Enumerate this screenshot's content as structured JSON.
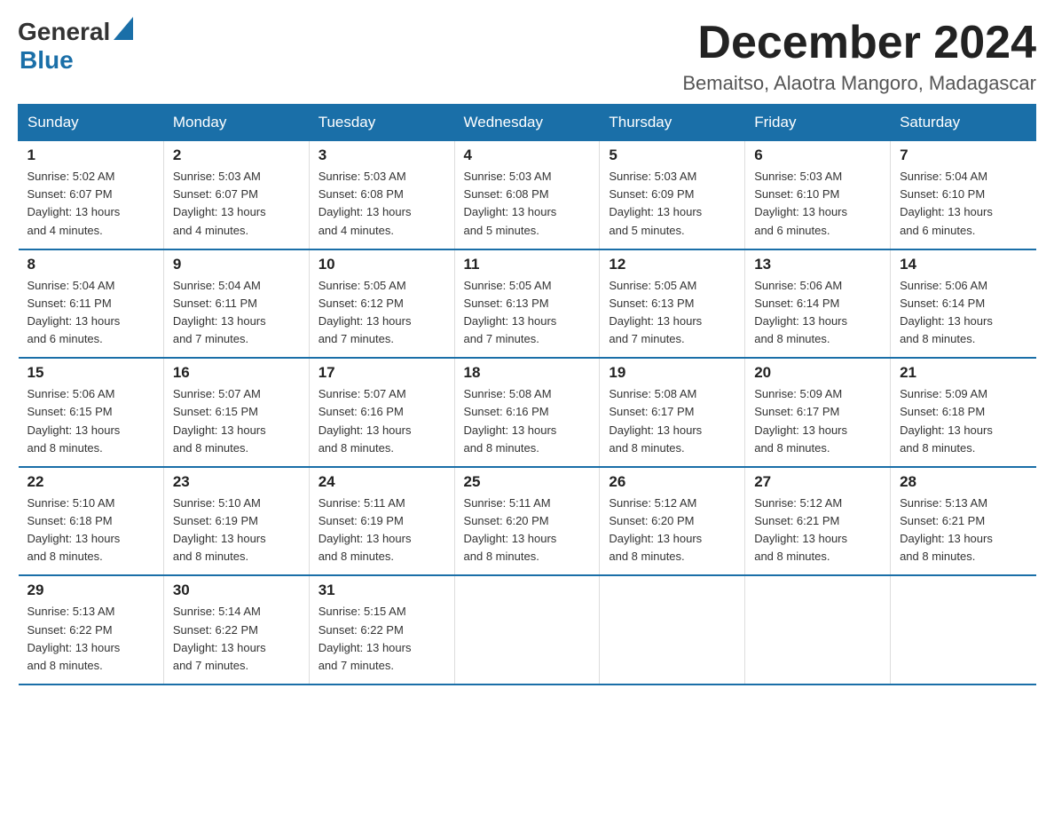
{
  "header": {
    "logo_general": "General",
    "logo_blue": "Blue",
    "title": "December 2024",
    "subtitle": "Bemaitso, Alaotra Mangoro, Madagascar"
  },
  "days_of_week": [
    "Sunday",
    "Monday",
    "Tuesday",
    "Wednesday",
    "Thursday",
    "Friday",
    "Saturday"
  ],
  "weeks": [
    [
      {
        "day": "1",
        "sunrise": "5:02 AM",
        "sunset": "6:07 PM",
        "daylight": "13 hours and 4 minutes."
      },
      {
        "day": "2",
        "sunrise": "5:03 AM",
        "sunset": "6:07 PM",
        "daylight": "13 hours and 4 minutes."
      },
      {
        "day": "3",
        "sunrise": "5:03 AM",
        "sunset": "6:08 PM",
        "daylight": "13 hours and 4 minutes."
      },
      {
        "day": "4",
        "sunrise": "5:03 AM",
        "sunset": "6:08 PM",
        "daylight": "13 hours and 5 minutes."
      },
      {
        "day": "5",
        "sunrise": "5:03 AM",
        "sunset": "6:09 PM",
        "daylight": "13 hours and 5 minutes."
      },
      {
        "day": "6",
        "sunrise": "5:03 AM",
        "sunset": "6:10 PM",
        "daylight": "13 hours and 6 minutes."
      },
      {
        "day": "7",
        "sunrise": "5:04 AM",
        "sunset": "6:10 PM",
        "daylight": "13 hours and 6 minutes."
      }
    ],
    [
      {
        "day": "8",
        "sunrise": "5:04 AM",
        "sunset": "6:11 PM",
        "daylight": "13 hours and 6 minutes."
      },
      {
        "day": "9",
        "sunrise": "5:04 AM",
        "sunset": "6:11 PM",
        "daylight": "13 hours and 7 minutes."
      },
      {
        "day": "10",
        "sunrise": "5:05 AM",
        "sunset": "6:12 PM",
        "daylight": "13 hours and 7 minutes."
      },
      {
        "day": "11",
        "sunrise": "5:05 AM",
        "sunset": "6:13 PM",
        "daylight": "13 hours and 7 minutes."
      },
      {
        "day": "12",
        "sunrise": "5:05 AM",
        "sunset": "6:13 PM",
        "daylight": "13 hours and 7 minutes."
      },
      {
        "day": "13",
        "sunrise": "5:06 AM",
        "sunset": "6:14 PM",
        "daylight": "13 hours and 8 minutes."
      },
      {
        "day": "14",
        "sunrise": "5:06 AM",
        "sunset": "6:14 PM",
        "daylight": "13 hours and 8 minutes."
      }
    ],
    [
      {
        "day": "15",
        "sunrise": "5:06 AM",
        "sunset": "6:15 PM",
        "daylight": "13 hours and 8 minutes."
      },
      {
        "day": "16",
        "sunrise": "5:07 AM",
        "sunset": "6:15 PM",
        "daylight": "13 hours and 8 minutes."
      },
      {
        "day": "17",
        "sunrise": "5:07 AM",
        "sunset": "6:16 PM",
        "daylight": "13 hours and 8 minutes."
      },
      {
        "day": "18",
        "sunrise": "5:08 AM",
        "sunset": "6:16 PM",
        "daylight": "13 hours and 8 minutes."
      },
      {
        "day": "19",
        "sunrise": "5:08 AM",
        "sunset": "6:17 PM",
        "daylight": "13 hours and 8 minutes."
      },
      {
        "day": "20",
        "sunrise": "5:09 AM",
        "sunset": "6:17 PM",
        "daylight": "13 hours and 8 minutes."
      },
      {
        "day": "21",
        "sunrise": "5:09 AM",
        "sunset": "6:18 PM",
        "daylight": "13 hours and 8 minutes."
      }
    ],
    [
      {
        "day": "22",
        "sunrise": "5:10 AM",
        "sunset": "6:18 PM",
        "daylight": "13 hours and 8 minutes."
      },
      {
        "day": "23",
        "sunrise": "5:10 AM",
        "sunset": "6:19 PM",
        "daylight": "13 hours and 8 minutes."
      },
      {
        "day": "24",
        "sunrise": "5:11 AM",
        "sunset": "6:19 PM",
        "daylight": "13 hours and 8 minutes."
      },
      {
        "day": "25",
        "sunrise": "5:11 AM",
        "sunset": "6:20 PM",
        "daylight": "13 hours and 8 minutes."
      },
      {
        "day": "26",
        "sunrise": "5:12 AM",
        "sunset": "6:20 PM",
        "daylight": "13 hours and 8 minutes."
      },
      {
        "day": "27",
        "sunrise": "5:12 AM",
        "sunset": "6:21 PM",
        "daylight": "13 hours and 8 minutes."
      },
      {
        "day": "28",
        "sunrise": "5:13 AM",
        "sunset": "6:21 PM",
        "daylight": "13 hours and 8 minutes."
      }
    ],
    [
      {
        "day": "29",
        "sunrise": "5:13 AM",
        "sunset": "6:22 PM",
        "daylight": "13 hours and 8 minutes."
      },
      {
        "day": "30",
        "sunrise": "5:14 AM",
        "sunset": "6:22 PM",
        "daylight": "13 hours and 7 minutes."
      },
      {
        "day": "31",
        "sunrise": "5:15 AM",
        "sunset": "6:22 PM",
        "daylight": "13 hours and 7 minutes."
      },
      null,
      null,
      null,
      null
    ]
  ],
  "labels": {
    "sunrise_prefix": "Sunrise: ",
    "sunset_prefix": "Sunset: ",
    "daylight_prefix": "Daylight: "
  },
  "colors": {
    "header_bg": "#1a6fa8",
    "border": "#1a6fa8",
    "logo_blue": "#1a6fa8"
  }
}
